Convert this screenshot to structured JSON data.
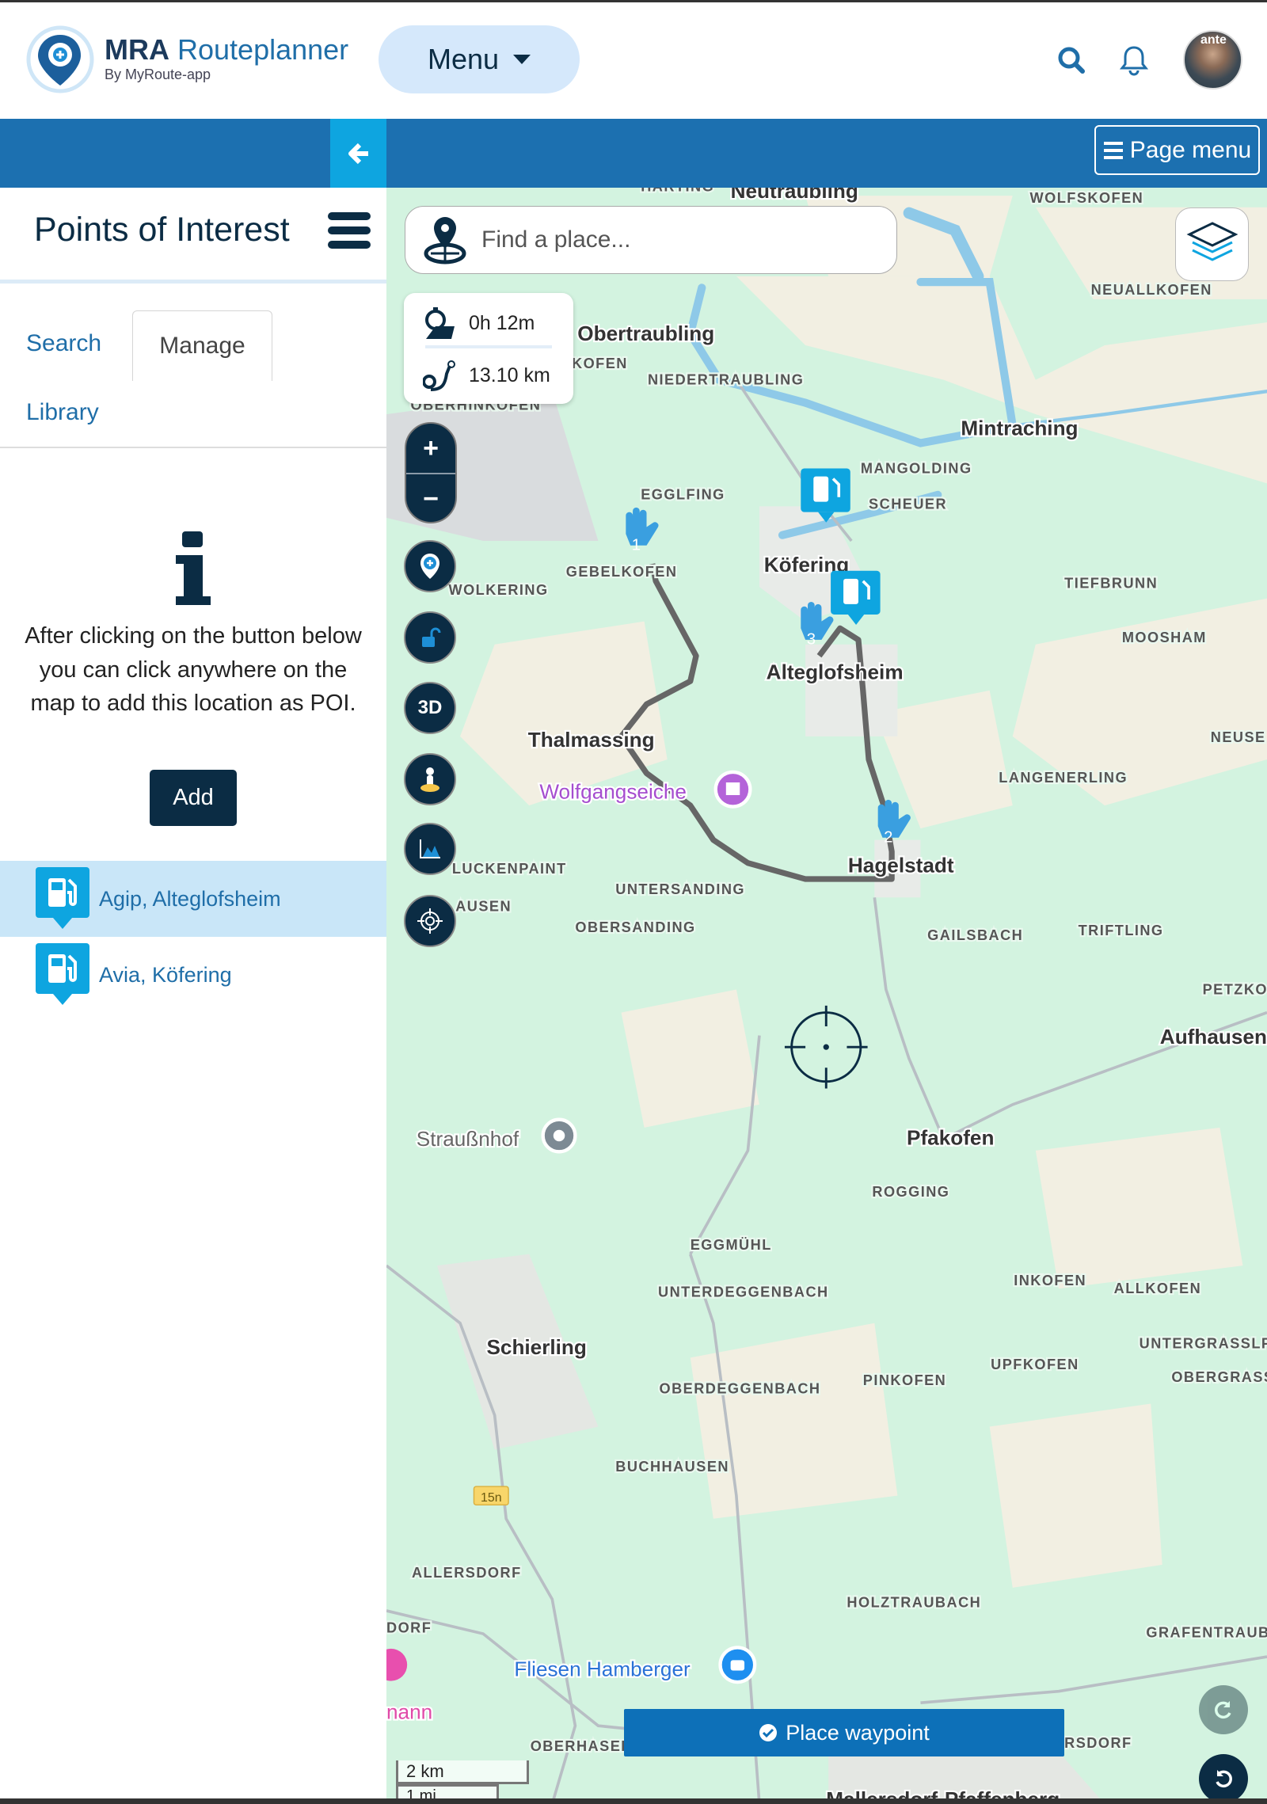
{
  "header": {
    "logo_title": "MRA Routeplanner",
    "logo_subtitle": "By MyRoute-app",
    "menu_label": "Menu",
    "page_menu_label": "Page menu",
    "avatar_text": "ante"
  },
  "sidebar": {
    "title": "Points of Interest",
    "tabs": [
      {
        "label": "Search",
        "active": false
      },
      {
        "label": "Manage",
        "active": true
      },
      {
        "label": "Library",
        "active": false
      }
    ],
    "info_text": "After clicking on the button below you can click anywhere on the map to add this location as POI.",
    "add_label": "Add",
    "poi_list": [
      {
        "label": "Agip, Alteglofsheim",
        "icon": "fuel-station-icon",
        "selected": true
      },
      {
        "label": "Avia, Köfering",
        "icon": "fuel-station-icon",
        "selected": false
      }
    ]
  },
  "map": {
    "search_placeholder": "Find a place...",
    "route_time": "0h 12m",
    "route_distance": "13.10 km",
    "zoom_in": "+",
    "zoom_out": "−",
    "btn_3d": "3D",
    "place_waypoint_label": "Place waypoint",
    "scale_km": "2 km",
    "scale_mi": "1 mi",
    "road_badge": "15n",
    "waypoints": [
      "1",
      "2",
      "3"
    ],
    "labels": {
      "harting": "HARTING",
      "neutraubling": "Neutraubling",
      "wolfskofen": "WOLFSKOFEN",
      "neuallkofen": "NEUALLKOFEN",
      "obertraubling": "Obertraubling",
      "kofen": "KOFEN",
      "niedertraubling": "NIEDERTRAUBLING",
      "oberhinkofen": "OBERHINKOFEN",
      "mintraching": "Mintraching",
      "mangolding": "MANGOLDING",
      "scheuer": "SCHEUER",
      "egglfing": "EGGLFING",
      "gebelkofen": "GEBELKOFEN",
      "wolkering": "WOLKERING",
      "koefering": "Köfering",
      "tiefbrunn": "TIEFBRUNN",
      "moosham": "MOOSHAM",
      "alteglofsheim": "Alteglofsheim",
      "thalmassing": "Thalmassing",
      "neuse": "NEUSE",
      "langenerling": "LANGENERLING",
      "wolfgangseiche": "Wolfgangseiche",
      "luckenpaint": "LUCKENPAINT",
      "hagelstadt": "Hagelstadt",
      "untersanding": "UNTERSANDING",
      "ausen": "AUSEN",
      "obersanding": "OBERSANDING",
      "gailsbach": "GAILSBACH",
      "triftling": "TRIFTLING",
      "petzko": "PETZKO",
      "aufhausen": "Aufhausen",
      "straussnhof": "Straußnhof",
      "pfakofen": "Pfakofen",
      "rogging": "ROGGING",
      "eggmuehl": "EGGMÜHL",
      "inkofen": "INKOFEN",
      "allkofen": "ALLKOFEN",
      "unterdeggenbach": "UNTERDEGGENBACH",
      "untergrasslf": "UNTERGRASSLF",
      "schierling": "Schierling",
      "obergrass": "OBERGRASS",
      "upfkofen": "UPFKOFEN",
      "pinkofen": "PINKOFEN",
      "oberdeggenbach": "OBERDEGGENBACH",
      "buchhausen": "BUCHHAUSEN",
      "allersdorf": "ALLERSDORF",
      "holztraubach": "HOLZTRAUBACH",
      "grafentraub": "GRAFENTRAUB",
      "dorf": "DORF",
      "fliesen": "Fliesen Hamberger",
      "nann": "nann",
      "oberhasel": "OBERHASEL",
      "rsdorf": "RSDORF",
      "mallersdorf": "Mallersdorf-Pfaffenberg"
    },
    "colors": {
      "route": "#666666",
      "fuel_marker": "#0ea5e0",
      "waypoint_marker": "#3a9fe0",
      "water": "#8ec9e8"
    }
  }
}
